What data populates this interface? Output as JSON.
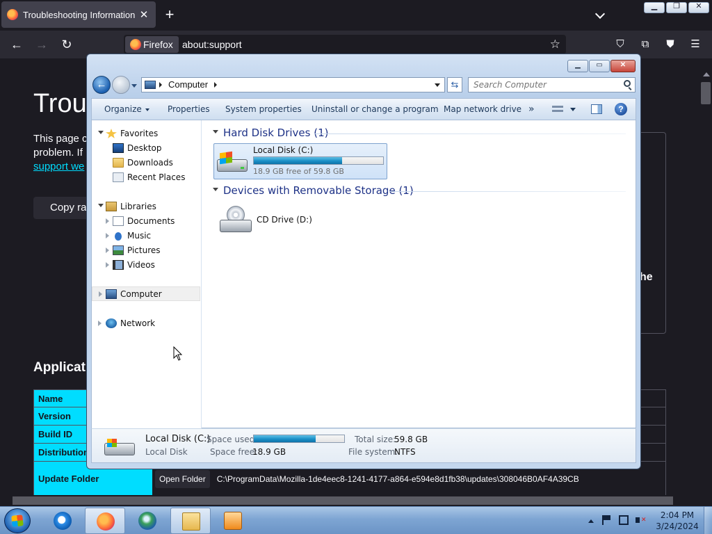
{
  "browser": {
    "tab_title": "Troubleshooting Information",
    "identity_label": "Firefox",
    "url": "about:support",
    "page": {
      "title_fragment": "Troub",
      "intro_line1": "This page c",
      "intro_line2": "problem. If",
      "intro_link": "support we",
      "copy_button": "Copy ra",
      "side_text": "he",
      "app_heading": "Applicati",
      "rows": [
        {
          "key": "Name",
          "value": ""
        },
        {
          "key": "Version",
          "value": ""
        },
        {
          "key": "Build ID",
          "value": ""
        },
        {
          "key": "Distribution",
          "value": ""
        },
        {
          "key": "Update Folder",
          "button": "Open Folder",
          "value": "C:\\ProgramData\\Mozilla-1de4eec8-1241-4177-a864-e594e8d1fb38\\updates\\308046B0AF4A39CB"
        }
      ]
    }
  },
  "explorer": {
    "breadcrumb": "Computer",
    "search_placeholder": "Search Computer",
    "commands": {
      "organize": "Organize",
      "properties": "Properties",
      "system_properties": "System properties",
      "uninstall": "Uninstall or change a program",
      "map_drive": "Map network drive",
      "more": "»"
    },
    "nav": {
      "favorites": "Favorites",
      "desktop": "Desktop",
      "downloads": "Downloads",
      "recent": "Recent Places",
      "libraries": "Libraries",
      "documents": "Documents",
      "music": "Music",
      "pictures": "Pictures",
      "videos": "Videos",
      "computer": "Computer",
      "network": "Network"
    },
    "groups": {
      "hdd": "Hard Disk Drives (1)",
      "removable": "Devices with Removable Storage (1)"
    },
    "drive_c": {
      "name": "Local Disk (C:)",
      "free_text": "18.9 GB free of 59.8 GB",
      "used_fraction": 0.684
    },
    "drive_d": {
      "name": "CD Drive (D:)"
    },
    "details": {
      "name": "Local Disk (C:)",
      "type": "Local Disk",
      "space_used_label": "Space used:",
      "space_free_label": "Space free:",
      "space_free_value": "18.9 GB",
      "total_size_label": "Total size:",
      "total_size_value": "59.8 GB",
      "file_system_label": "File system:",
      "file_system_value": "NTFS"
    }
  },
  "taskbar": {
    "time": "2:04 PM",
    "date": "3/24/2024"
  }
}
